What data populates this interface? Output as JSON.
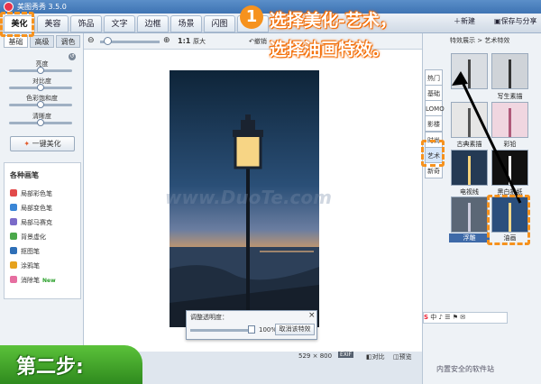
{
  "window": {
    "title": "美图秀秀 3.5.0"
  },
  "tabs": [
    {
      "label": "美化",
      "active": true
    },
    {
      "label": "美容"
    },
    {
      "label": "饰品"
    },
    {
      "label": "文字"
    },
    {
      "label": "边框"
    },
    {
      "label": "场景"
    },
    {
      "label": "闪图"
    },
    {
      "label": "娃"
    }
  ],
  "header_actions": {
    "new": "新建",
    "save_share": "保存与分享"
  },
  "left_panel": {
    "subtabs": [
      "基础",
      "高级",
      "调色"
    ],
    "sliders": [
      {
        "label": "亮度",
        "value": 0.5
      },
      {
        "label": "对比度",
        "value": 0.5
      },
      {
        "label": "色彩饱和度",
        "value": 0.5
      },
      {
        "label": "清晰度",
        "value": 0.5
      }
    ],
    "onekey_label": "一键美化",
    "brush_title": "各种画笔",
    "brushes": [
      {
        "label": "局部彩色笔",
        "color": "#e24a4a"
      },
      {
        "label": "局部变色笔",
        "color": "#3a86d6"
      },
      {
        "label": "局部马赛克",
        "color": "#7b6bc9"
      },
      {
        "label": "背景虚化",
        "color": "#4aa84a"
      },
      {
        "label": "抠图笔",
        "color": "#2e6fb7"
      },
      {
        "label": "涂鸦笔",
        "color": "#e6a21d"
      },
      {
        "label": "消除笔",
        "color": "#e66ea0",
        "badge": "New"
      }
    ]
  },
  "toolbar": {
    "zoom_ratio": "1:1",
    "original": "原大",
    "undo": "撤销"
  },
  "right_panel": {
    "header": "特效展示 > 艺术特效",
    "categories": [
      "热门",
      "基础",
      "LOMO",
      "影楼",
      "时尚",
      "艺术",
      "新奇"
    ],
    "active_category": "艺术",
    "effects": [
      "",
      "",
      "古典素描",
      "写生素描",
      "彩铅",
      "电视线",
      "黑白报纸",
      "浮雕",
      "油画"
    ],
    "selected_effect": "油画"
  },
  "dialog": {
    "title": "调整透明度：",
    "percent": "100%",
    "cancel_label": "取消该特效"
  },
  "status": {
    "width": "529",
    "x": "×",
    "height": "800",
    "exif": "EXIF",
    "compare": "对比",
    "preview": "预览"
  },
  "annotation": {
    "number": "1",
    "line1": "选择美化-艺术，",
    "line2": "选择油画特效。",
    "step": "第二步:"
  },
  "watermark": {
    "text": "www.DuoTe.com",
    "site": "内置安全的软件站"
  },
  "colors": {
    "accent_orange": "#f6921e",
    "banner_green": "#3ea82a"
  }
}
